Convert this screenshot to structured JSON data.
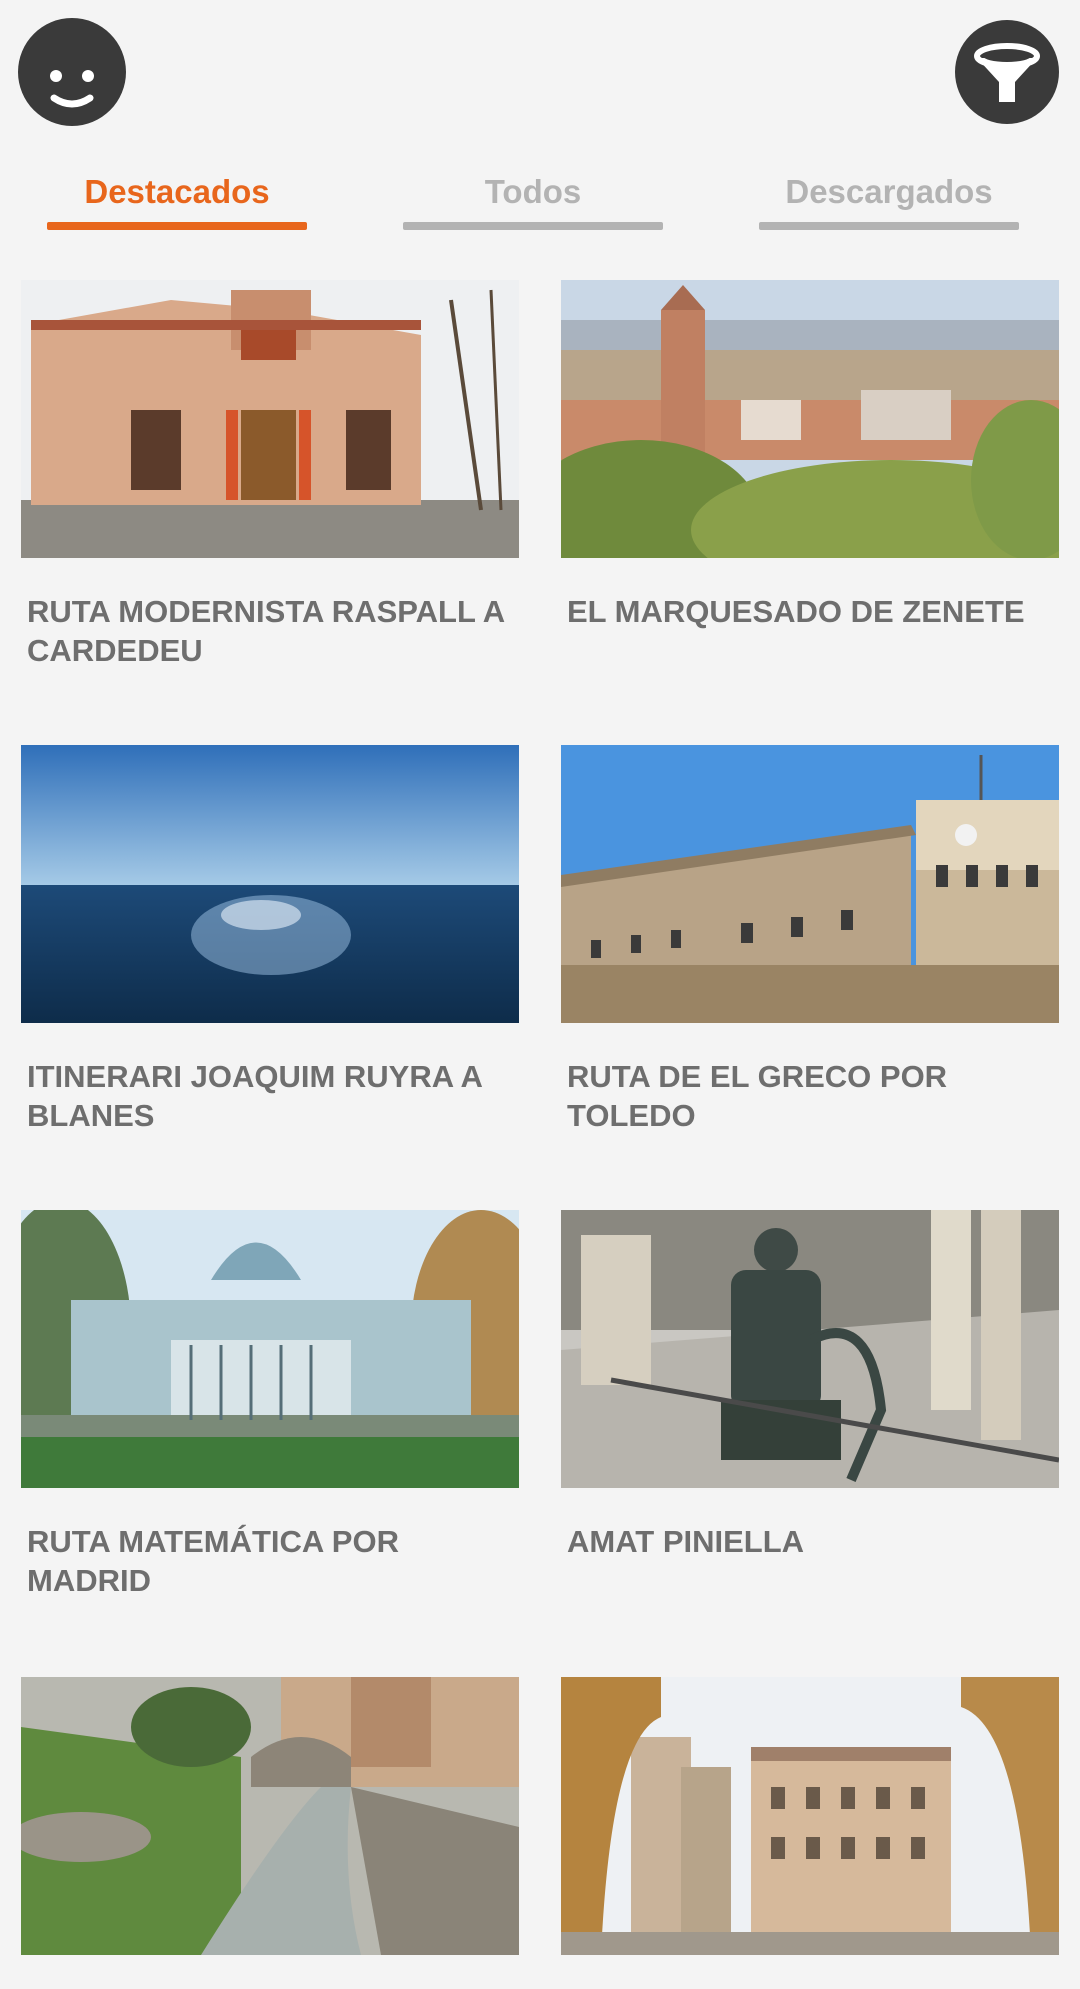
{
  "header": {
    "avatar_icon": "smiley-face-icon",
    "filter_icon": "funnel-filter-icon"
  },
  "tabs": [
    {
      "label": "Destacados",
      "active": true
    },
    {
      "label": "Todos",
      "active": false
    },
    {
      "label": "Descargados",
      "active": false
    }
  ],
  "colors": {
    "accent": "#e8661c",
    "inactive": "#b3b3b3",
    "dark": "#3a3a3a"
  },
  "routes": [
    {
      "title": "RUTA MODERNISTA RASPALL A CARDEDEU"
    },
    {
      "title": "EL MARQUESADO DE ZENETE"
    },
    {
      "title": "ITINERARI JOAQUIM RUYRA A BLANES"
    },
    {
      "title": "RUTA DE EL GRECO POR TOLEDO"
    },
    {
      "title": "RUTA MATEMÁTICA POR MADRID"
    },
    {
      "title": "AMAT PINIELLA"
    },
    {
      "title": ""
    },
    {
      "title": ""
    }
  ]
}
